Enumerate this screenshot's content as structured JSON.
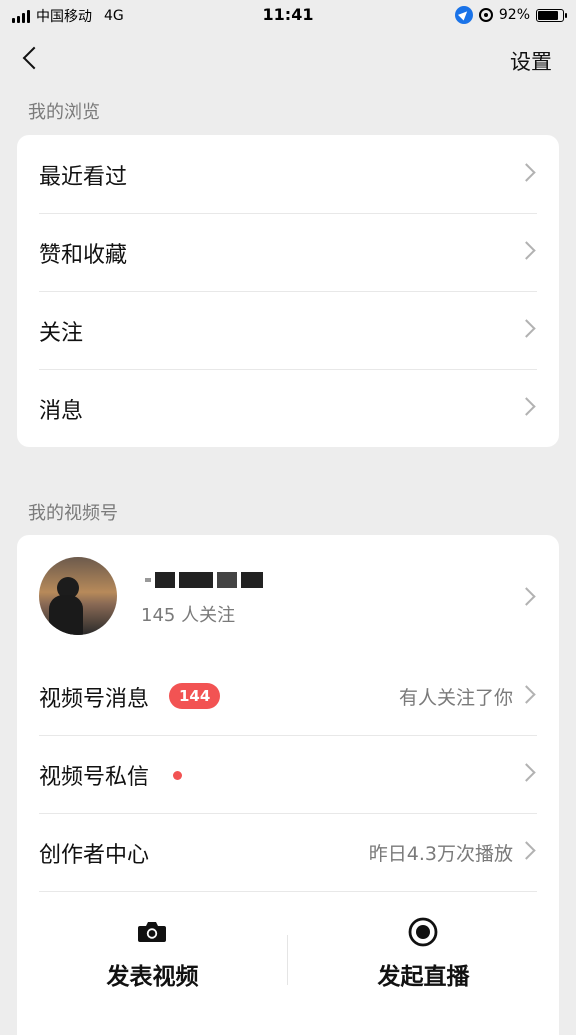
{
  "status_bar": {
    "carrier": "中国移动",
    "network": "4G",
    "time": "11:41",
    "battery": "92%",
    "battery_level": 0.92
  },
  "nav": {
    "settings_label": "设置"
  },
  "browse": {
    "title": "我的浏览",
    "items": [
      {
        "label": "最近看过"
      },
      {
        "label": "赞和收藏"
      },
      {
        "label": "关注"
      },
      {
        "label": "消息"
      }
    ]
  },
  "channels": {
    "title": "我的视频号",
    "profile": {
      "followers": "145 人关注"
    },
    "items": [
      {
        "label": "视频号消息",
        "badge": "144",
        "value": "有人关注了你"
      },
      {
        "label": "视频号私信",
        "value": ""
      },
      {
        "label": "创作者中心",
        "value": "昨日4.3万次播放"
      }
    ],
    "actions": [
      {
        "label": "发表视频",
        "icon": "camera-icon"
      },
      {
        "label": "发起直播",
        "icon": "live-record-icon"
      }
    ]
  },
  "colors": {
    "badge": "#f25353",
    "background": "#ededed",
    "card": "#ffffff"
  }
}
